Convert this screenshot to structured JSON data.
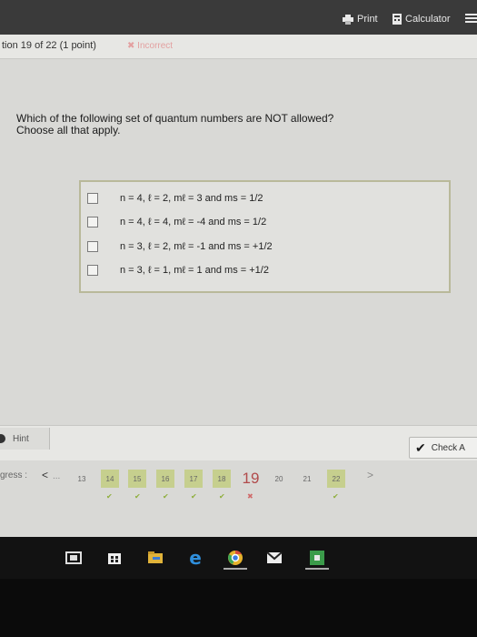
{
  "topbar": {
    "print_label": "Print",
    "calculator_label": "Calculator"
  },
  "question_header": {
    "number_label": "tion 19 of 22 (1 point)",
    "status_label": "Incorrect"
  },
  "question": {
    "prompt_line1": "Which of the following set of quantum numbers are NOT allowed?",
    "prompt_line2": "Choose all that apply."
  },
  "options": [
    {
      "label": "n = 4, ℓ = 2, mℓ = 3 and ms = 1/2"
    },
    {
      "label": "n = 4, ℓ = 4, mℓ = -4 and ms = 1/2"
    },
    {
      "label": "n = 3, ℓ = 2, mℓ = -1 and ms = +1/2"
    },
    {
      "label": "n = 3, ℓ = 1, mℓ = 1 and ms = +1/2"
    }
  ],
  "footer": {
    "hint_label": "Hint",
    "check_label": "Check A"
  },
  "progress": {
    "label": "gress :",
    "prev_symbol": "<",
    "ellipsis": "...",
    "next_symbol": ">",
    "pages": [
      "13",
      "14",
      "15",
      "16",
      "17",
      "18",
      "19",
      "20",
      "21",
      "22"
    ],
    "check_symbol": "✔",
    "x_symbol": "✖"
  },
  "colors": {
    "topbar": "#3a3a3a",
    "correct_page": "#c6cf8e",
    "incorrect": "#b14b4b",
    "check_green": "#8eae3b"
  },
  "icons": [
    "printer-icon",
    "calculator-icon",
    "menu-icon",
    "hint-icon",
    "checkmark-icon",
    "task-view-icon",
    "store-icon",
    "file-explorer-icon",
    "edge-icon",
    "chrome-icon",
    "mail-icon",
    "app-icon"
  ]
}
